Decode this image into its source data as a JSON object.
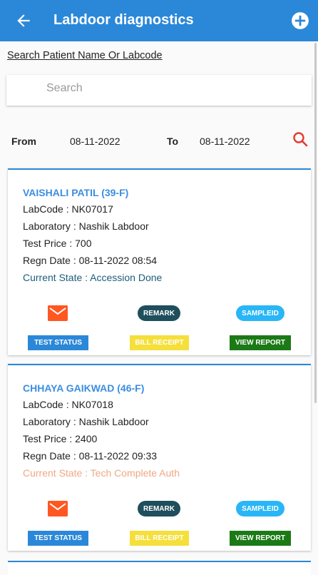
{
  "app": {
    "title": "Labdoor diagnostics"
  },
  "search": {
    "label": "Search Patient Name Or Labcode",
    "placeholder": "Search"
  },
  "dates": {
    "from_label": "From",
    "from_value": "08-11-2022",
    "to_label": "To",
    "to_value": "08-11-2022"
  },
  "colors": {
    "accent": "#2b88d8",
    "state_done": "#1c5d7a",
    "state_tech": "#f0a883"
  },
  "patients": [
    {
      "name": "VAISHALI PATIL  (39-F)",
      "labcode": "LabCode : NK07017",
      "laboratory": "Laboratory : Nashik Labdoor",
      "price": "Test Price : 700",
      "regn": "Regn Date : 08-11-2022 08:54",
      "state": "Current State : Accession Done",
      "remark_label": "REMARK",
      "sampled_label": "SAMPLEID",
      "test_status_label": "TEST STATUS",
      "bill_label": "BILL RECEIPT",
      "view_label": "VIEW REPORT"
    },
    {
      "name": "CHHAYA GAIKWAD  (46-F)",
      "labcode": "LabCode : NK07018",
      "laboratory": "Laboratory : Nashik Labdoor",
      "price": "Test Price : 2400",
      "regn": "Regn Date : 08-11-2022 09:33",
      "state": "Current State : Tech Complete Auth",
      "remark_label": "REMARK",
      "sampled_label": "SAMPLEID",
      "test_status_label": "TEST STATUS",
      "bill_label": "BILL RECEIPT",
      "view_label": "VIEW REPORT"
    }
  ]
}
